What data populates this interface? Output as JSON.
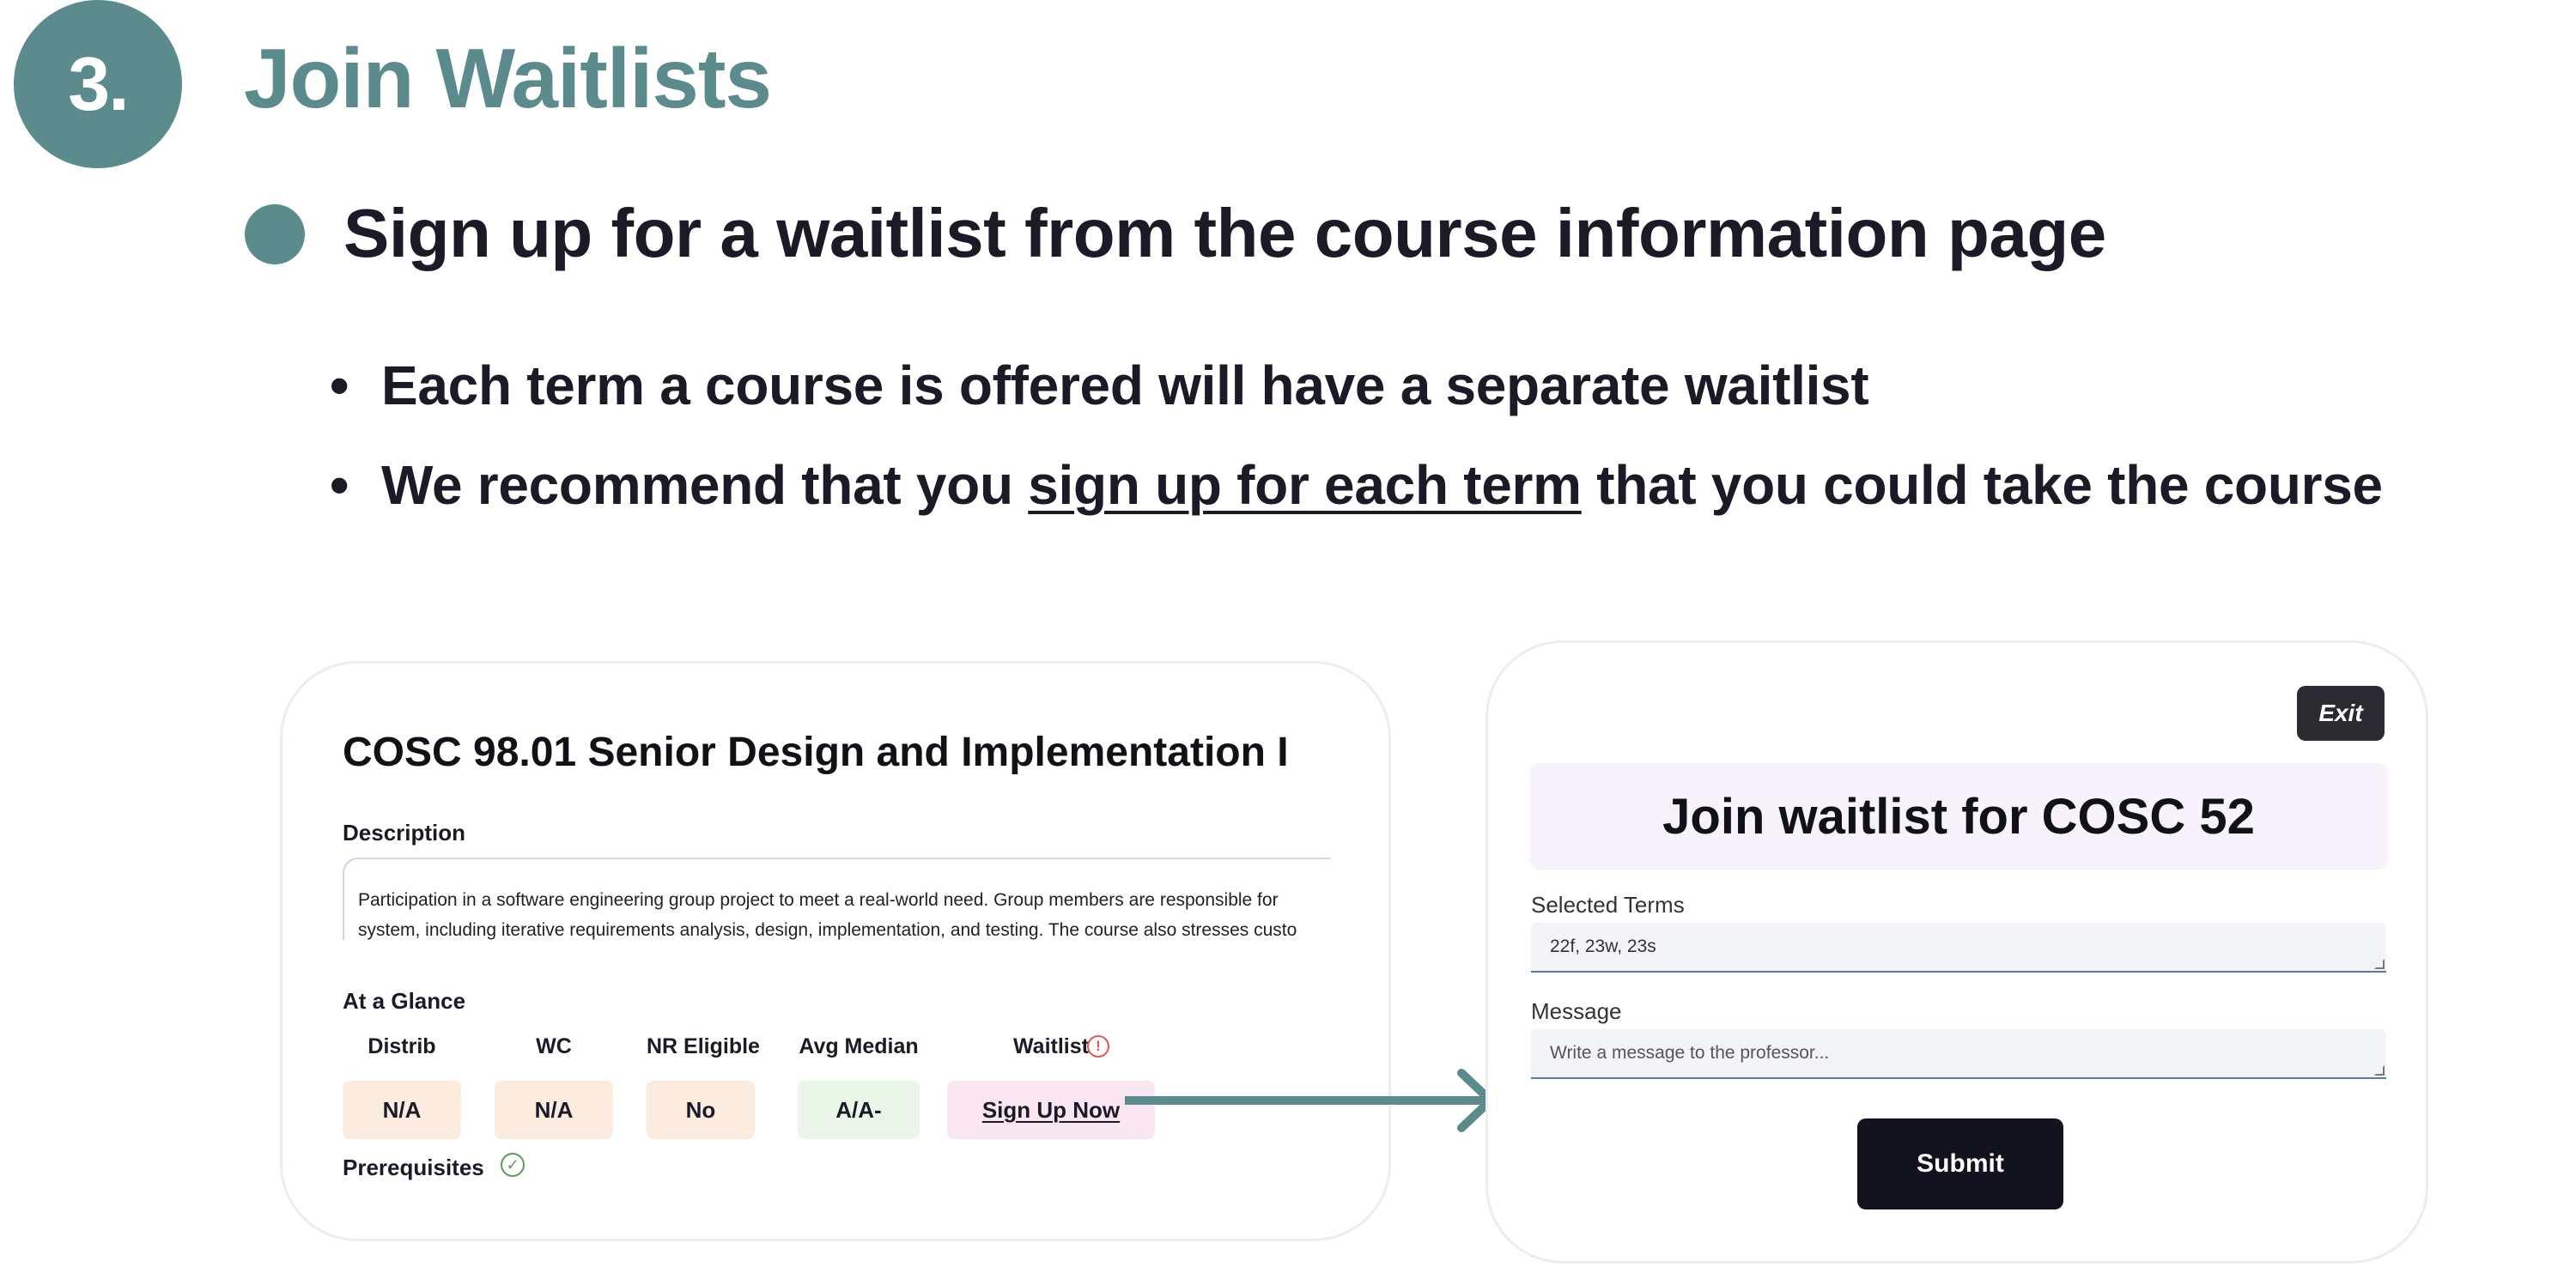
{
  "step": {
    "number": "3.",
    "title": "Join Waitlists"
  },
  "main_point": "Sign up for a waitlist from the course information page",
  "sub_points": {
    "first": "Each term a course is offered will have a separate waitlist",
    "second_before": "We recommend that you ",
    "second_underlined": "sign up for each term",
    "second_after": " that you could take the course"
  },
  "course_card": {
    "title": "COSC 98.01 Senior Design and Implementation I",
    "description_label": "Description",
    "description_lines": [
      "Participation in a software engineering group project to meet a real-world need. Group members are responsible for",
      "system, including iterative requirements analysis, design, implementation, and testing. The course also stresses custo"
    ],
    "glance_label": "At a Glance",
    "glance": [
      {
        "header": "Distrib",
        "value": "N/A"
      },
      {
        "header": "WC",
        "value": "N/A"
      },
      {
        "header": "NR Eligible",
        "value": "No"
      },
      {
        "header": "Avg Median",
        "value": "A/A-"
      },
      {
        "header": "Waitlist",
        "value": "Sign Up Now"
      }
    ],
    "prerequisites_label": "Prerequisites"
  },
  "waitlist_form": {
    "exit_label": "Exit",
    "header": "Join waitlist for COSC 52",
    "selected_terms_label": "Selected Terms",
    "selected_terms_value": "22f, 23w, 23s",
    "message_label": "Message",
    "message_placeholder": "Write a message to the professor...",
    "submit_label": "Submit"
  },
  "icons": {
    "warning": "alert-circle-icon",
    "check": "check-circle-icon",
    "arrow": "arrow-right-icon"
  },
  "colors": {
    "accent": "#5b8b8c",
    "text": "#1b1b28",
    "peach": "#fcecdf",
    "mint": "#eaf6e8",
    "pink": "#fae6f1",
    "dark_button": "#13121f"
  }
}
